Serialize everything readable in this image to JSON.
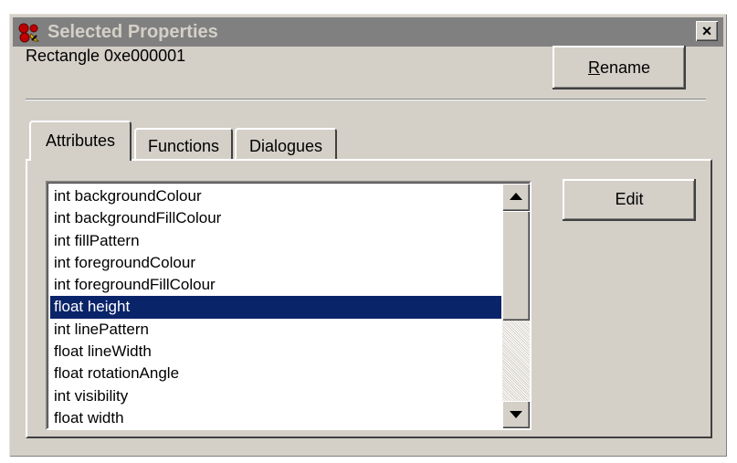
{
  "window": {
    "title": "Selected Properties",
    "close_glyph": "×",
    "icon": "shapes-icon"
  },
  "object": {
    "label": "Rectangle 0xe000001"
  },
  "rename_button": {
    "mnemonic": "R",
    "rest": "ename"
  },
  "tabs": [
    {
      "label": "Attributes",
      "active": true
    },
    {
      "label": "Functions",
      "active": false
    },
    {
      "label": "Dialogues",
      "active": false
    }
  ],
  "attributes": [
    {
      "text": "int backgroundColour",
      "selected": false
    },
    {
      "text": "int backgroundFillColour",
      "selected": false
    },
    {
      "text": "int fillPattern",
      "selected": false
    },
    {
      "text": "int foregroundColour",
      "selected": false
    },
    {
      "text": "int foregroundFillColour",
      "selected": false
    },
    {
      "text": "float height",
      "selected": true
    },
    {
      "text": "int linePattern",
      "selected": false
    },
    {
      "text": "float lineWidth",
      "selected": false
    },
    {
      "text": "float rotationAngle",
      "selected": false
    },
    {
      "text": "int visibility",
      "selected": false
    },
    {
      "text": "float width",
      "selected": false
    }
  ],
  "edit_button": {
    "label": "Edit"
  },
  "colors": {
    "titlebar_inactive": "#808080",
    "selection": "#0a246a",
    "face": "#d4d0c8"
  }
}
